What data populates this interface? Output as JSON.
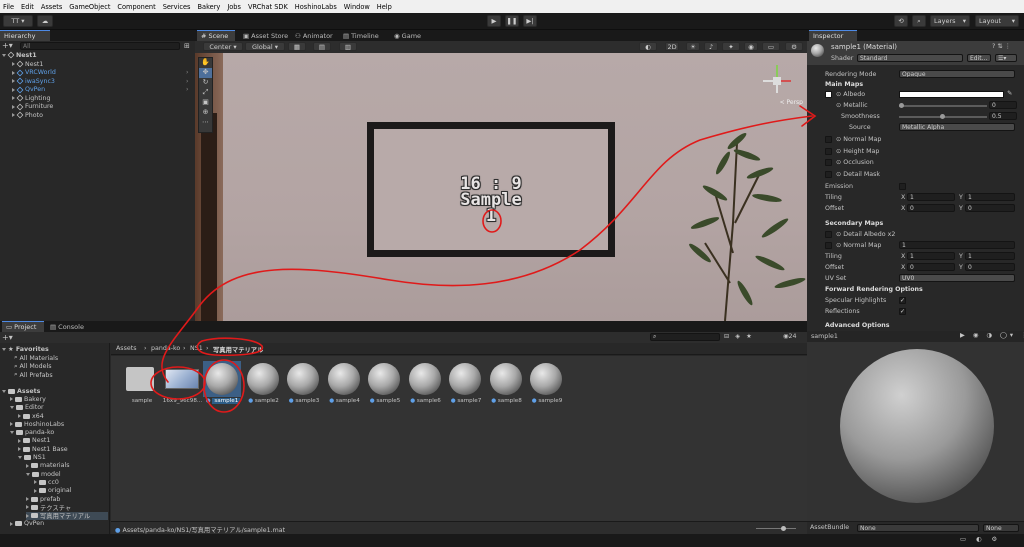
{
  "menu": [
    "File",
    "Edit",
    "Assets",
    "GameObject",
    "Component",
    "Services",
    "Bakery",
    "Jobs",
    "VRChat SDK",
    "HoshinoLabs",
    "Window",
    "Help"
  ],
  "toolbar": {
    "account": "TT",
    "layers": "Layers",
    "layout": "Layout"
  },
  "hierarchy": {
    "tab": "Hierarchy",
    "search_placeholder": "All",
    "root": "Nest1",
    "items": [
      {
        "label": "Nest1",
        "blue": false
      },
      {
        "label": "VRCWorld",
        "blue": true
      },
      {
        "label": "iwaSync3",
        "blue": true
      },
      {
        "label": "QvPen",
        "blue": true
      },
      {
        "label": "Lighting",
        "blue": false
      },
      {
        "label": "Furniture",
        "blue": false
      },
      {
        "label": "Photo",
        "blue": false
      }
    ]
  },
  "scene": {
    "tabs": [
      "Scene",
      "Asset Store",
      "Animator",
      "Timeline",
      "Game"
    ],
    "pivot": "Center",
    "space": "Global",
    "mode2d": "2D",
    "persp": "< Persp",
    "sign_line1": "16 : 9",
    "sign_line2": "Sample",
    "sign_line3": "1"
  },
  "inspector": {
    "tab": "Inspector",
    "title": "sample1 (Material)",
    "shader_label": "Shader",
    "shader": "Standard",
    "edit": "Edit...",
    "rendering_mode_label": "Rendering Mode",
    "rendering_mode": "Opaque",
    "main_maps": "Main Maps",
    "albedo": "Albedo",
    "metallic": "Metallic",
    "metallic_val": "0",
    "smoothness": "Smoothness",
    "smoothness_val": "0.5",
    "source_label": "Source",
    "source": "Metallic Alpha",
    "normal_map": "Normal Map",
    "height_map": "Height Map",
    "occlusion": "Occlusion",
    "detail_mask": "Detail Mask",
    "emission": "Emission",
    "tiling": "Tiling",
    "offset": "Offset",
    "tiling_x": "1",
    "tiling_y": "1",
    "offset_x": "0",
    "offset_y": "0",
    "secondary_maps": "Secondary Maps",
    "detail_albedo": "Detail Albedo x2",
    "sec_normal": "Normal Map",
    "sec_normal_val": "1",
    "sec_tiling_x": "1",
    "sec_tiling_y": "1",
    "sec_offset_x": "0",
    "sec_offset_y": "0",
    "uv_set_label": "UV Set",
    "uv_set": "UV0",
    "forward_options": "Forward Rendering Options",
    "specular": "Specular Highlights",
    "reflections": "Reflections",
    "advanced": "Advanced Options",
    "preview_name": "sample1",
    "assetbundle_label": "AssetBundle",
    "assetbundle": "None",
    "assetbundle_variant": "None",
    "x": "X",
    "y": "Y"
  },
  "project": {
    "tabs": [
      "Project",
      "Console"
    ],
    "breadcrumb": [
      "Assets",
      "panda-ko",
      "NS1",
      "写真用マテリアル"
    ],
    "count": "24",
    "favorites": "Favorites",
    "fav_items": [
      "All Materials",
      "All Models",
      "All Prefabs"
    ],
    "tree": [
      {
        "label": "Assets",
        "indent": 0,
        "open": true,
        "bold": true
      },
      {
        "label": "Bakery",
        "indent": 1,
        "open": false
      },
      {
        "label": "Editor",
        "indent": 1,
        "open": true
      },
      {
        "label": "x64",
        "indent": 2,
        "open": false
      },
      {
        "label": "HoshinoLabs",
        "indent": 1,
        "open": false
      },
      {
        "label": "panda-ko",
        "indent": 1,
        "open": true
      },
      {
        "label": "Nest1",
        "indent": 2,
        "open": false
      },
      {
        "label": "Nest1 Base",
        "indent": 2,
        "open": false
      },
      {
        "label": "NS1",
        "indent": 2,
        "open": true
      },
      {
        "label": "materials",
        "indent": 3,
        "open": false
      },
      {
        "label": "model",
        "indent": 3,
        "open": true
      },
      {
        "label": "cc0",
        "indent": 4,
        "open": false
      },
      {
        "label": "original",
        "indent": 4,
        "open": false
      },
      {
        "label": "prefab",
        "indent": 3,
        "open": false
      },
      {
        "label": "テクスチャ",
        "indent": 3,
        "open": false
      },
      {
        "label": "写真用マテリアル",
        "indent": 3,
        "open": false
      },
      {
        "label": "QvPen",
        "indent": 1,
        "open": false
      }
    ],
    "assets": [
      "sample",
      "16x9_96c98...",
      "sample1",
      "sample2",
      "sample3",
      "sample4",
      "sample5",
      "sample6",
      "sample7",
      "sample8",
      "sample9"
    ],
    "path": "Assets/panda-ko/NS1/写真用マテリアル/sample1.mat"
  },
  "colors": {
    "accent": "#4e8ae5",
    "annotation": "#e01a1a",
    "selected": "#2c5d87"
  }
}
